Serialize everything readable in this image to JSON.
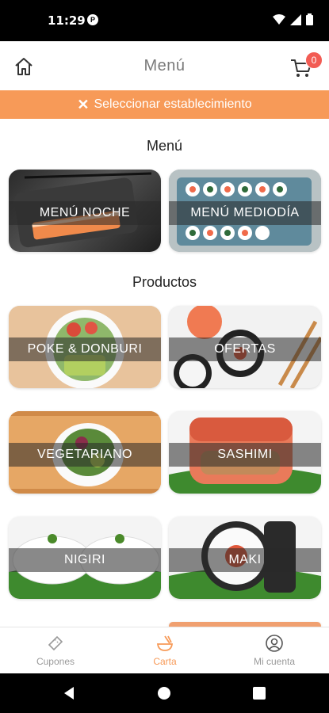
{
  "status": {
    "time": "11:29",
    "app_icon": "P"
  },
  "header": {
    "title": "Menú",
    "cart_count": "0"
  },
  "select_bar": {
    "label": "Seleccionar establecimiento"
  },
  "sections": {
    "menu_title": "Menú",
    "products_title": "Productos"
  },
  "menu_tiles": [
    {
      "label": "MENÚ NOCHE"
    },
    {
      "label": "MENÚ MEDIODÍA"
    }
  ],
  "product_tiles": [
    {
      "label": "POKE & DONBURI"
    },
    {
      "label": "OFERTAS"
    },
    {
      "label": "VEGETARIANO"
    },
    {
      "label": "SASHIMI"
    },
    {
      "label": "NIGIRI"
    },
    {
      "label": "MAKI"
    }
  ],
  "bottom_nav": [
    {
      "label": "Cupones",
      "icon": "ticket-icon"
    },
    {
      "label": "Carta",
      "icon": "sushi-bowl-icon"
    },
    {
      "label": "Mi cuenta",
      "icon": "account-icon"
    }
  ],
  "colors": {
    "accent": "#f79a58",
    "badge": "#f25c54",
    "band": "#3c3c3c"
  }
}
